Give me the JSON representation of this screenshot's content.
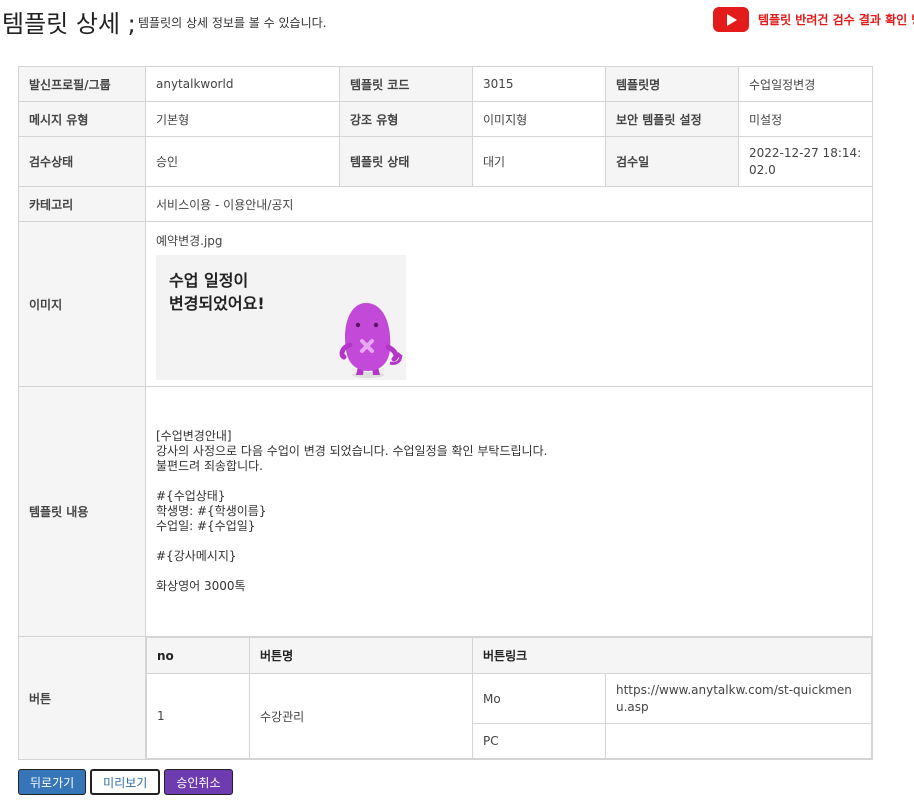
{
  "header": {
    "title": "템플릿 상세 ;",
    "subtitle": "템플릿의 상세 정보를 볼 수 있습니다.",
    "youtube_link": "템플릿 반려건 검수 결과 확인 방법"
  },
  "detail": {
    "profile_label": "발신프로필/그룹",
    "profile_value": "anytalkworld",
    "code_label": "템플릿 코드",
    "code_value": "3015",
    "name_label": "템플릿명",
    "name_value": "수업일정변경",
    "msgtype_label": "메시지 유형",
    "msgtype_value": "기본형",
    "emph_label": "강조 유형",
    "emph_value": "이미지형",
    "secure_label": "보안 템플릿 설정",
    "secure_value": "미설정",
    "review_label": "검수상태",
    "review_value": "승인",
    "status_label": "템플릿 상태",
    "status_value": "대기",
    "reviewdate_label": "검수일",
    "reviewdate_value": "2022-12-27 18:14:02.0",
    "category_label": "카테고리",
    "category_value": "서비스이용 - 이용안내/공지",
    "image_label": "이미지",
    "image_file": "예약변경.jpg",
    "image_text_line1": "수업 일정이",
    "image_text_line2": "변경되었어요!",
    "content_label": "템플릿 내용",
    "content_text": "[수업변경안내]\n강사의 사정으로 다음 수업이 변경 되었습니다. 수업일정을 확인 부탁드립니다.\n불편드려 죄송합니다.\n\n#{수업상태}\n학생명: #{학생이름}\n수업일: #{수업일}\n\n#{강사메시지}\n\n화상영어 3000톡",
    "button_label": "버튼"
  },
  "buttons_table": {
    "headers": [
      "no",
      "버튼명",
      "버튼링크"
    ],
    "rows": [
      {
        "no": "1",
        "name": "수강관리",
        "mo_label": "Mo",
        "mo_link": "https://www.anytalkw.com/st-quickmenu.asp",
        "pc_label": "PC",
        "pc_link": ""
      }
    ]
  },
  "actions": {
    "back": "뒤로가기",
    "preview": "미리보기",
    "cancel_approval": "승인취소"
  },
  "colors": {
    "youtube_red": "#e31b1b",
    "back_button": "#3575b8",
    "cancel_button": "#6f3bb0",
    "header_cell_bg": "#f5f5f5"
  }
}
